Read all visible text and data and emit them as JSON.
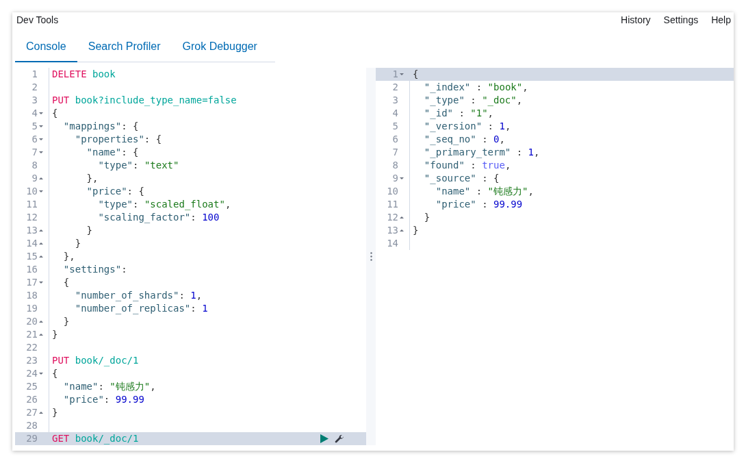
{
  "window": {
    "title": "Dev Tools"
  },
  "top_menu": [
    {
      "label": "History"
    },
    {
      "label": "Settings"
    },
    {
      "label": "Help"
    }
  ],
  "tabs": [
    {
      "label": "Console",
      "selected": true
    },
    {
      "label": "Search Profiler",
      "selected": false
    },
    {
      "label": "Grok Debugger",
      "selected": false
    }
  ],
  "request_editor": {
    "lines": [
      {
        "number": "1",
        "fold_start": false,
        "fold_end": false,
        "highlighted": false,
        "actions": false,
        "tokens": [
          {
            "kind": "method",
            "text": "DELETE"
          },
          {
            "kind": "url",
            "text": " book"
          }
        ]
      },
      {
        "number": "2",
        "fold_start": false,
        "fold_end": false,
        "highlighted": false,
        "actions": false
      },
      {
        "number": "3",
        "fold_start": false,
        "fold_end": false,
        "highlighted": false,
        "actions": false,
        "tokens": [
          {
            "kind": "method",
            "text": "PUT"
          },
          {
            "kind": "url",
            "text": " book?include_type_name=false"
          }
        ]
      },
      {
        "number": "4",
        "fold_start": true,
        "fold_end": false,
        "highlighted": false,
        "actions": false,
        "tokens": [
          {
            "kind": "punct",
            "text": "{"
          }
        ]
      },
      {
        "number": "5",
        "fold_start": true,
        "fold_end": false,
        "highlighted": false,
        "actions": false,
        "tokens": [
          {
            "kind": "key",
            "text": "  \"mappings\""
          },
          {
            "kind": "punct",
            "text": ": {"
          }
        ]
      },
      {
        "number": "6",
        "fold_start": true,
        "fold_end": false,
        "highlighted": false,
        "actions": false,
        "tokens": [
          {
            "kind": "key",
            "text": "    \"properties\""
          },
          {
            "kind": "punct",
            "text": ": {"
          }
        ]
      },
      {
        "number": "7",
        "fold_start": true,
        "fold_end": false,
        "highlighted": false,
        "actions": false,
        "tokens": [
          {
            "kind": "key",
            "text": "      \"name\""
          },
          {
            "kind": "punct",
            "text": ": {"
          }
        ]
      },
      {
        "number": "8",
        "fold_start": false,
        "fold_end": false,
        "highlighted": false,
        "actions": false,
        "tokens": [
          {
            "kind": "key",
            "text": "        \"type\""
          },
          {
            "kind": "punct",
            "text": ": "
          },
          {
            "kind": "string",
            "text": "\"text\""
          }
        ]
      },
      {
        "number": "9",
        "fold_start": false,
        "fold_end": true,
        "highlighted": false,
        "actions": false,
        "tokens": [
          {
            "kind": "punct",
            "text": "      },"
          }
        ]
      },
      {
        "number": "10",
        "fold_start": true,
        "fold_end": false,
        "highlighted": false,
        "actions": false,
        "tokens": [
          {
            "kind": "key",
            "text": "      \"price\""
          },
          {
            "kind": "punct",
            "text": ": {"
          }
        ]
      },
      {
        "number": "11",
        "fold_start": false,
        "fold_end": false,
        "highlighted": false,
        "actions": false,
        "tokens": [
          {
            "kind": "key",
            "text": "        \"type\""
          },
          {
            "kind": "punct",
            "text": ": "
          },
          {
            "kind": "string",
            "text": "\"scaled_float\""
          },
          {
            "kind": "punct",
            "text": ","
          }
        ]
      },
      {
        "number": "12",
        "fold_start": false,
        "fold_end": false,
        "highlighted": false,
        "actions": false,
        "tokens": [
          {
            "kind": "key",
            "text": "        \"scaling_factor\""
          },
          {
            "kind": "punct",
            "text": ": "
          },
          {
            "kind": "number",
            "text": "100"
          }
        ]
      },
      {
        "number": "13",
        "fold_start": false,
        "fold_end": true,
        "highlighted": false,
        "actions": false,
        "tokens": [
          {
            "kind": "punct",
            "text": "      }"
          }
        ]
      },
      {
        "number": "14",
        "fold_start": false,
        "fold_end": true,
        "highlighted": false,
        "actions": false,
        "tokens": [
          {
            "kind": "punct",
            "text": "    }"
          }
        ]
      },
      {
        "number": "15",
        "fold_start": false,
        "fold_end": true,
        "highlighted": false,
        "actions": false,
        "tokens": [
          {
            "kind": "punct",
            "text": "  },"
          }
        ]
      },
      {
        "number": "16",
        "fold_start": false,
        "fold_end": false,
        "highlighted": false,
        "actions": false,
        "tokens": [
          {
            "kind": "key",
            "text": "  \"settings\""
          },
          {
            "kind": "punct",
            "text": ":"
          }
        ]
      },
      {
        "number": "17",
        "fold_start": true,
        "fold_end": false,
        "highlighted": false,
        "actions": false,
        "tokens": [
          {
            "kind": "punct",
            "text": "  {"
          }
        ]
      },
      {
        "number": "18",
        "fold_start": false,
        "fold_end": false,
        "highlighted": false,
        "actions": false,
        "tokens": [
          {
            "kind": "key",
            "text": "    \"number_of_shards\""
          },
          {
            "kind": "punct",
            "text": ": "
          },
          {
            "kind": "number",
            "text": "1"
          },
          {
            "kind": "punct",
            "text": ","
          }
        ]
      },
      {
        "number": "19",
        "fold_start": false,
        "fold_end": false,
        "highlighted": false,
        "actions": false,
        "tokens": [
          {
            "kind": "key",
            "text": "    \"number_of_replicas\""
          },
          {
            "kind": "punct",
            "text": ": "
          },
          {
            "kind": "number",
            "text": "1"
          }
        ]
      },
      {
        "number": "20",
        "fold_start": false,
        "fold_end": true,
        "highlighted": false,
        "actions": false,
        "tokens": [
          {
            "kind": "punct",
            "text": "  }"
          }
        ]
      },
      {
        "number": "21",
        "fold_start": false,
        "fold_end": true,
        "highlighted": false,
        "actions": false,
        "tokens": [
          {
            "kind": "punct",
            "text": "}"
          }
        ]
      },
      {
        "number": "22",
        "fold_start": false,
        "fold_end": false,
        "highlighted": false,
        "actions": false
      },
      {
        "number": "23",
        "fold_start": false,
        "fold_end": false,
        "highlighted": false,
        "actions": false,
        "tokens": [
          {
            "kind": "method",
            "text": "PUT"
          },
          {
            "kind": "url",
            "text": " book/_doc/1"
          }
        ]
      },
      {
        "number": "24",
        "fold_start": true,
        "fold_end": false,
        "highlighted": false,
        "actions": false,
        "tokens": [
          {
            "kind": "punct",
            "text": "{"
          }
        ]
      },
      {
        "number": "25",
        "fold_start": false,
        "fold_end": false,
        "highlighted": false,
        "actions": false,
        "tokens": [
          {
            "kind": "key",
            "text": "  \"name\""
          },
          {
            "kind": "punct",
            "text": ": "
          },
          {
            "kind": "string",
            "text": "\"钝感力\""
          },
          {
            "kind": "punct",
            "text": ","
          }
        ]
      },
      {
        "number": "26",
        "fold_start": false,
        "fold_end": false,
        "highlighted": false,
        "actions": false,
        "tokens": [
          {
            "kind": "key",
            "text": "  \"price\""
          },
          {
            "kind": "punct",
            "text": ": "
          },
          {
            "kind": "number",
            "text": "99.99"
          }
        ]
      },
      {
        "number": "27",
        "fold_start": false,
        "fold_end": true,
        "highlighted": false,
        "actions": false,
        "tokens": [
          {
            "kind": "punct",
            "text": "}"
          }
        ]
      },
      {
        "number": "28",
        "fold_start": false,
        "fold_end": false,
        "highlighted": false,
        "actions": false
      },
      {
        "number": "29",
        "fold_start": false,
        "fold_end": false,
        "highlighted": true,
        "actions": true,
        "tokens": [
          {
            "kind": "method",
            "text": "GET"
          },
          {
            "kind": "url",
            "text": " book/_doc/1"
          }
        ]
      }
    ]
  },
  "response_viewer": {
    "lines": [
      {
        "number": "1",
        "fold_start": true,
        "fold_end": false,
        "highlighted": true,
        "actions": false,
        "tokens": [
          {
            "kind": "punct",
            "text": "{"
          }
        ]
      },
      {
        "number": "2",
        "fold_start": false,
        "fold_end": false,
        "highlighted": false,
        "actions": false,
        "tokens": [
          {
            "kind": "key",
            "text": "  \"_index\""
          },
          {
            "kind": "punct",
            "text": " : "
          },
          {
            "kind": "string",
            "text": "\"book\""
          },
          {
            "kind": "punct",
            "text": ","
          }
        ]
      },
      {
        "number": "3",
        "fold_start": false,
        "fold_end": false,
        "highlighted": false,
        "actions": false,
        "tokens": [
          {
            "kind": "key",
            "text": "  \"_type\""
          },
          {
            "kind": "punct",
            "text": " : "
          },
          {
            "kind": "string",
            "text": "\"_doc\""
          },
          {
            "kind": "punct",
            "text": ","
          }
        ]
      },
      {
        "number": "4",
        "fold_start": false,
        "fold_end": false,
        "highlighted": false,
        "actions": false,
        "tokens": [
          {
            "kind": "key",
            "text": "  \"_id\""
          },
          {
            "kind": "punct",
            "text": " : "
          },
          {
            "kind": "string",
            "text": "\"1\""
          },
          {
            "kind": "punct",
            "text": ","
          }
        ]
      },
      {
        "number": "5",
        "fold_start": false,
        "fold_end": false,
        "highlighted": false,
        "actions": false,
        "tokens": [
          {
            "kind": "key",
            "text": "  \"_version\""
          },
          {
            "kind": "punct",
            "text": " : "
          },
          {
            "kind": "number",
            "text": "1"
          },
          {
            "kind": "punct",
            "text": ","
          }
        ]
      },
      {
        "number": "6",
        "fold_start": false,
        "fold_end": false,
        "highlighted": false,
        "actions": false,
        "tokens": [
          {
            "kind": "key",
            "text": "  \"_seq_no\""
          },
          {
            "kind": "punct",
            "text": " : "
          },
          {
            "kind": "number",
            "text": "0"
          },
          {
            "kind": "punct",
            "text": ","
          }
        ]
      },
      {
        "number": "7",
        "fold_start": false,
        "fold_end": false,
        "highlighted": false,
        "actions": false,
        "tokens": [
          {
            "kind": "key",
            "text": "  \"_primary_term\""
          },
          {
            "kind": "punct",
            "text": " : "
          },
          {
            "kind": "number",
            "text": "1"
          },
          {
            "kind": "punct",
            "text": ","
          }
        ]
      },
      {
        "number": "8",
        "fold_start": false,
        "fold_end": false,
        "highlighted": false,
        "actions": false,
        "tokens": [
          {
            "kind": "key",
            "text": "  \"found\""
          },
          {
            "kind": "punct",
            "text": " : "
          },
          {
            "kind": "boolean",
            "text": "true"
          },
          {
            "kind": "punct",
            "text": ","
          }
        ]
      },
      {
        "number": "9",
        "fold_start": true,
        "fold_end": false,
        "highlighted": false,
        "actions": false,
        "tokens": [
          {
            "kind": "key",
            "text": "  \"_source\""
          },
          {
            "kind": "punct",
            "text": " : {"
          }
        ]
      },
      {
        "number": "10",
        "fold_start": false,
        "fold_end": false,
        "highlighted": false,
        "actions": false,
        "tokens": [
          {
            "kind": "key",
            "text": "    \"name\""
          },
          {
            "kind": "punct",
            "text": " : "
          },
          {
            "kind": "string",
            "text": "\"钝感力\""
          },
          {
            "kind": "punct",
            "text": ","
          }
        ]
      },
      {
        "number": "11",
        "fold_start": false,
        "fold_end": false,
        "highlighted": false,
        "actions": false,
        "tokens": [
          {
            "kind": "key",
            "text": "    \"price\""
          },
          {
            "kind": "punct",
            "text": " : "
          },
          {
            "kind": "number",
            "text": "99.99"
          }
        ]
      },
      {
        "number": "12",
        "fold_start": false,
        "fold_end": true,
        "highlighted": false,
        "actions": false,
        "tokens": [
          {
            "kind": "punct",
            "text": "  }"
          }
        ]
      },
      {
        "number": "13",
        "fold_start": false,
        "fold_end": true,
        "highlighted": false,
        "actions": false,
        "tokens": [
          {
            "kind": "punct",
            "text": "}"
          }
        ]
      },
      {
        "number": "14",
        "fold_start": false,
        "fold_end": false,
        "highlighted": false,
        "actions": false
      }
    ]
  }
}
